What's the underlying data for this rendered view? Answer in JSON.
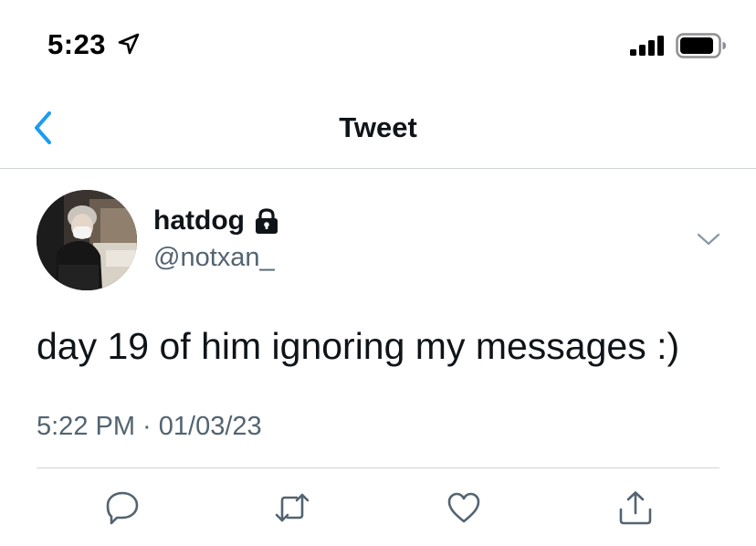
{
  "status_bar": {
    "time": "5:23",
    "location_icon": "location-arrow-icon",
    "signal_icon": "cellular-signal-icon",
    "battery_icon": "battery-icon"
  },
  "nav": {
    "back_icon": "chevron-left-icon",
    "title": "Tweet"
  },
  "tweet": {
    "author": {
      "display_name": "hatdog",
      "handle": "@notxan_",
      "protected_icon": "lock-icon"
    },
    "text": "day 19 of him ignoring my messages :)",
    "timestamp": "5:22 PM · 01/03/23",
    "menu_icon": "chevron-down-icon"
  },
  "actions": [
    {
      "name": "reply",
      "icon": "comment-icon"
    },
    {
      "name": "retweet",
      "icon": "retweet-icon"
    },
    {
      "name": "like",
      "icon": "heart-icon"
    },
    {
      "name": "share",
      "icon": "share-icon"
    }
  ],
  "colors": {
    "accent": "#1d9bf0",
    "text_primary": "#0f1419",
    "text_secondary": "#536471",
    "divider": "#cfd4d9"
  }
}
